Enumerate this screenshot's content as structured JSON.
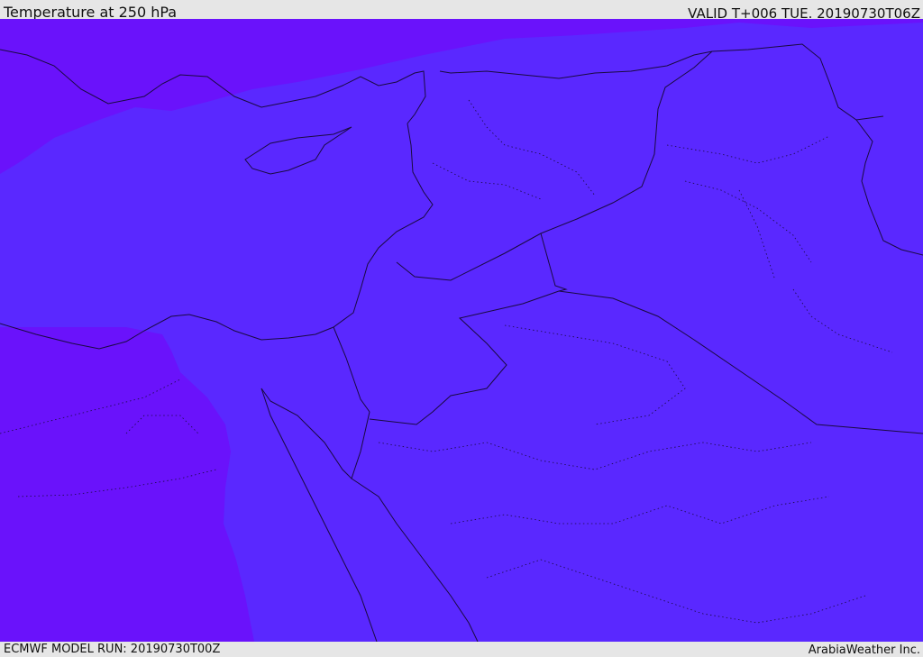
{
  "header": {
    "title": "Temperature at 250 hPa",
    "valid": "VALID T+006 TUE. 20190730T06Z"
  },
  "footer": {
    "model_run": "ECMWF MODEL RUN: 20190730T00Z",
    "brand": "ArabiaWeather Inc."
  },
  "colors": {
    "warm_band": "#5a28ff",
    "cool_band": "#6a12fb",
    "border_line": "#1a0a40",
    "frame": "#e6e6e6"
  },
  "legend": {
    "field": "temperature",
    "level_hpa": 250
  }
}
